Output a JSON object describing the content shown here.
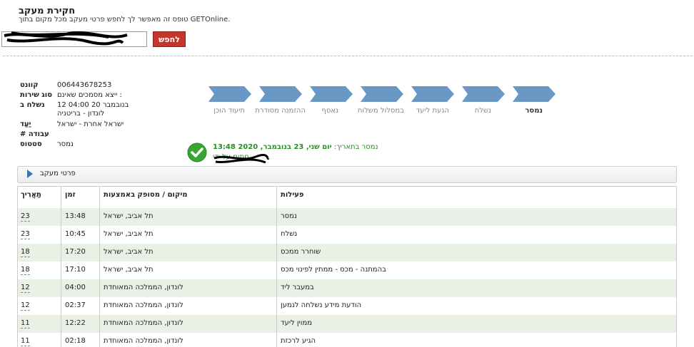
{
  "header": {
    "title": "חקירת מעקב",
    "subtitle": "טופס זה מאפשר לך לחפש פרטי מעקב מכל מקום בתוך GETOnline.",
    "search_button": "לחפש"
  },
  "info": [
    {
      "label": "קוונט",
      "value": "006443678253"
    },
    {
      "label": "סוג שירות",
      "value": "ייצא מסמכים שאינם :"
    },
    {
      "label": "נשלח ב",
      "value": "בנובמבר 20 04:00 12"
    },
    {
      "label": "",
      "value": "לונדון - בריטניה"
    },
    {
      "label": "יַעַד",
      "value": "ישראל אחרת - ישראל"
    },
    {
      "label": "# עבודה",
      "value": ""
    },
    {
      "label": "סטטוס",
      "value": "נמסר"
    }
  ],
  "steps": [
    {
      "label": "תיעוד הוכן",
      "active": false
    },
    {
      "label": "ההזמנה מסודרת",
      "active": false
    },
    {
      "label": "נאסף",
      "active": false
    },
    {
      "label": "במסלול משלוח",
      "active": false
    },
    {
      "label": "הגעת ליעד",
      "active": false
    },
    {
      "label": "נשלח",
      "active": false
    },
    {
      "label": "נמסר",
      "active": true
    }
  ],
  "status": {
    "delivered_prefix": "נמסר בתאריך:",
    "delivered_date": "יום שני, 23 בנובמבר, 2020 13:48",
    "signed_by": "חתום על ידי"
  },
  "tracking_bar": {
    "label": "פרטי מעקב"
  },
  "table": {
    "headers": {
      "date": "תַאֲרִיך",
      "time": "זמן",
      "location": "מיקום / מסופק באמצעות",
      "activity": "פעילות"
    },
    "rows": [
      {
        "date": "23",
        "time": "13:48",
        "location": "תל אביב, ישראל",
        "activity": "נמסר"
      },
      {
        "date": "23",
        "time": "10:45",
        "location": "תל אביב, ישראל",
        "activity": "נשלח"
      },
      {
        "date": "18",
        "time": "17:20",
        "location": "תל אביב, ישראל",
        "activity": "שוחרר ממכס"
      },
      {
        "date": "18",
        "time": "17:10",
        "location": "תל אביב, ישראל",
        "activity": "בהמתנה - מכס - ממתין לפינוי מכס"
      },
      {
        "date": "12",
        "time": "04:00",
        "location": "לונדון, הממלכה המאוחדת",
        "activity": "במעבר ליד"
      },
      {
        "date": "12",
        "time": "02:37",
        "location": "לונדון, הממלכה המאוחדת",
        "activity": "הודעת מידע נשלחה לנמען"
      },
      {
        "date": "11",
        "time": "12:22",
        "location": "לונדון, הממלכה המאוחדת",
        "activity": "ממוין ליעד"
      },
      {
        "date": "11",
        "time": "02:18",
        "location": "לונדון, הממלכה המאוחדת",
        "activity": "הגיע לרכזת"
      }
    ]
  },
  "colors": {
    "step_blue": "#6a98c4",
    "button_red": "#c4352b",
    "green": "#2d8a27",
    "row_green": "#e9f1e7"
  }
}
